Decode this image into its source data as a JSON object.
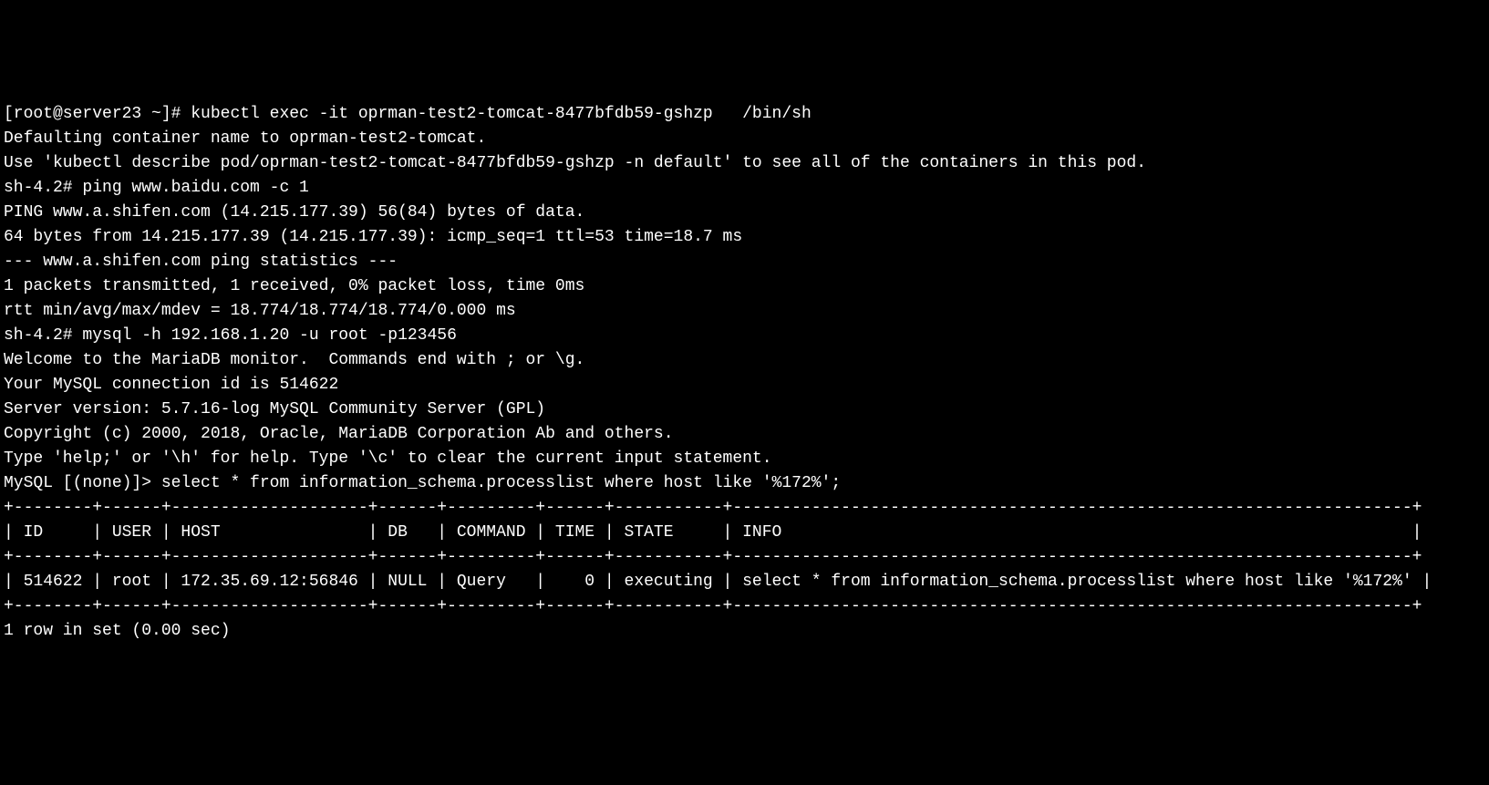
{
  "lines": {
    "l1": "[root@server23 ~]# kubectl exec -it oprman-test2-tomcat-8477bfdb59-gshzp   /bin/sh",
    "l2": "Defaulting container name to oprman-test2-tomcat.",
    "l3": "Use 'kubectl describe pod/oprman-test2-tomcat-8477bfdb59-gshzp -n default' to see all of the containers in this pod.",
    "l4": "sh-4.2# ping www.baidu.com -c 1",
    "l5": "PING www.a.shifen.com (14.215.177.39) 56(84) bytes of data.",
    "l6": "64 bytes from 14.215.177.39 (14.215.177.39): icmp_seq=1 ttl=53 time=18.7 ms",
    "l7": "",
    "l8": "--- www.a.shifen.com ping statistics ---",
    "l9": "1 packets transmitted, 1 received, 0% packet loss, time 0ms",
    "l10": "rtt min/avg/max/mdev = 18.774/18.774/18.774/0.000 ms",
    "l11": "sh-4.2# mysql -h 192.168.1.20 -u root -p123456",
    "l12": "Welcome to the MariaDB monitor.  Commands end with ; or \\g.",
    "l13": "Your MySQL connection id is 514622",
    "l14": "Server version: 5.7.16-log MySQL Community Server (GPL)",
    "l15": "",
    "l16": "Copyright (c) 2000, 2018, Oracle, MariaDB Corporation Ab and others.",
    "l17": "",
    "l18": "Type 'help;' or '\\h' for help. Type '\\c' to clear the current input statement.",
    "l19": "",
    "l20": "MySQL [(none)]> select * from information_schema.processlist where host like '%172%';",
    "l21": "+--------+------+--------------------+------+---------+------+-----------+---------------------------------------------------------------------+",
    "l22": "| ID     | USER | HOST               | DB   | COMMAND | TIME | STATE     | INFO                                                                |",
    "l23": "+--------+------+--------------------+------+---------+------+-----------+---------------------------------------------------------------------+",
    "l24": "| 514622 | root | 172.35.69.12:56846 | NULL | Query   |    0 | executing | select * from information_schema.processlist where host like '%172%' |",
    "l25": "+--------+------+--------------------+------+---------+------+-----------+---------------------------------------------------------------------+",
    "l26": "1 row in set (0.00 sec)"
  }
}
